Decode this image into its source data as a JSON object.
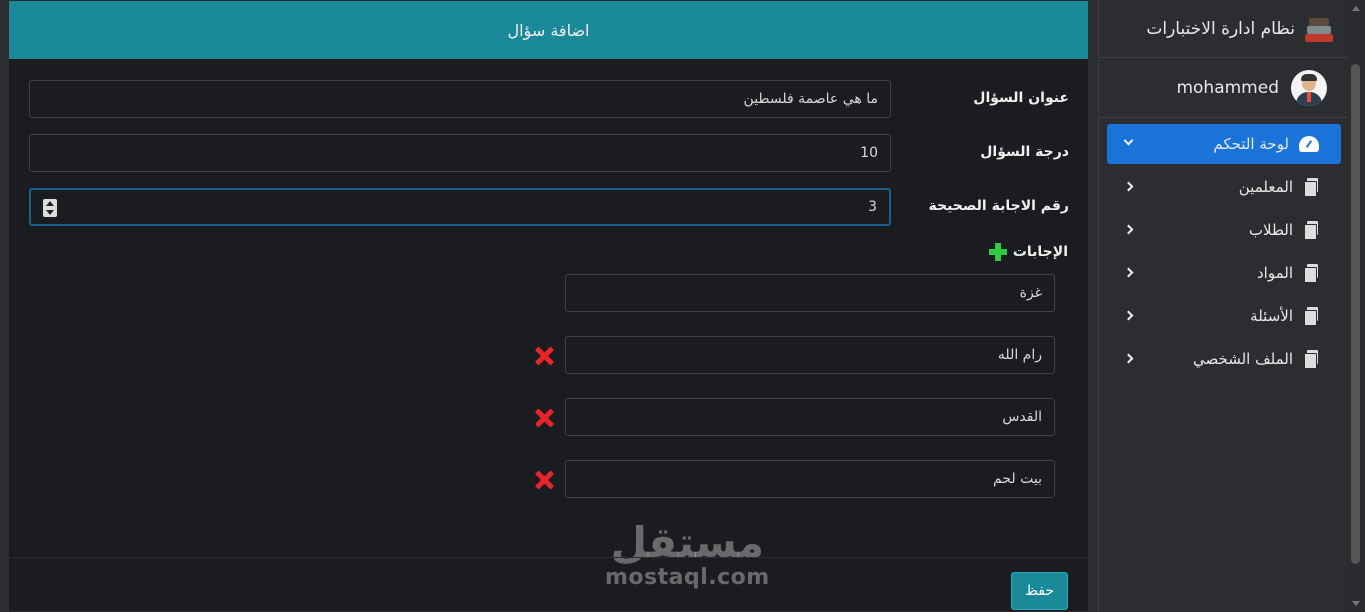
{
  "modal": {
    "title": "اضافة سؤال",
    "fields": {
      "question_title_label": "عنوان السؤال",
      "question_title_value": "ما هي عاصمة فلسطين",
      "question_grade_label": "درجة السؤال",
      "question_grade_value": "10",
      "correct_answer_label": "رقم الاجابة الصحيحة",
      "correct_answer_value": "3"
    },
    "answers_label": "الإجابات",
    "answers": [
      "غزة",
      "رام الله",
      "القدس",
      "بيت لحم"
    ],
    "save_label": "حفظ"
  },
  "watermark": {
    "arabic": "مستقل",
    "latin": "mostaql.com"
  },
  "sidebar": {
    "brand": "نظام ادارة الاختبارات",
    "username": "mohammed",
    "items": [
      {
        "label": "لوحة التحكم",
        "icon": "dashboard-icon",
        "active": true
      },
      {
        "label": "المعلمين",
        "icon": "copy-icon",
        "active": false
      },
      {
        "label": "الطلاب",
        "icon": "copy-icon",
        "active": false
      },
      {
        "label": "المواد",
        "icon": "copy-icon",
        "active": false
      },
      {
        "label": "الأسئلة",
        "icon": "copy-icon",
        "active": false
      },
      {
        "label": "الملف الشخصي",
        "icon": "copy-icon",
        "active": false
      }
    ]
  },
  "colors": {
    "header": "#1a8a9a",
    "active_menu": "#1a73d9",
    "add": "#2ecc40",
    "delete": "#e5252a"
  }
}
